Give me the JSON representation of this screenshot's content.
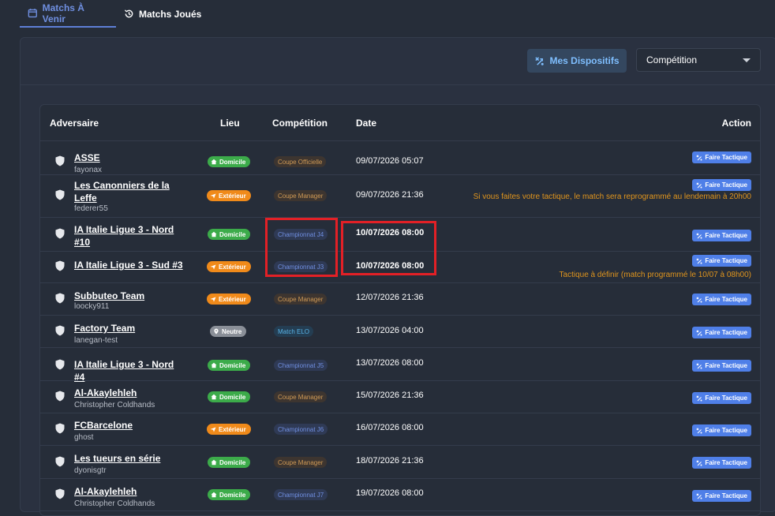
{
  "tabs": [
    {
      "label": "Matchs À Venir",
      "icon": "calendar-icon",
      "active": true
    },
    {
      "label": "Matchs Joués",
      "icon": "history-icon",
      "active": false
    }
  ],
  "toolbar": {
    "dispositifs_label": "Mes Dispositifs",
    "select_value": "Compétition"
  },
  "table": {
    "headers": {
      "adversaire": "Adversaire",
      "lieu": "Lieu",
      "competition": "Compétition",
      "date": "Date",
      "action": "Action"
    },
    "action_label": "Faire Tactique",
    "rows": [
      {
        "name": "ASSE",
        "sub": "fayonax",
        "lieu": "Domicile",
        "competition": "Coupe Officielle",
        "date": "09/07/2026 05:07"
      },
      {
        "name": "Les Canonniers de la Leffe",
        "sub": "federer55",
        "lieu": "Extérieur",
        "competition": "Coupe Manager",
        "date": "09/07/2026 21:36",
        "note": "Si vous faites votre tactique, le match sera reprogrammé au lendemain à 20h00"
      },
      {
        "name": "IA Italie Ligue 3 - Nord #10",
        "sub": "",
        "lieu": "Domicile",
        "competition": "Championnat J4",
        "date": "10/07/2026 08:00"
      },
      {
        "name": "IA Italie Ligue 3 - Sud #3",
        "sub": "",
        "lieu": "Extérieur",
        "competition": "Championnat J3",
        "date": "10/07/2026 08:00",
        "note": "Tactique à définir (match programmé le 10/07 à 08h00)"
      },
      {
        "name": "Subbuteo Team",
        "sub": "loocky911",
        "lieu": "Extérieur",
        "competition": "Coupe Manager",
        "date": "12/07/2026 21:36"
      },
      {
        "name": "Factory Team",
        "sub": "lanegan-test",
        "lieu": "Neutre",
        "competition": "Match ELO",
        "date": "13/07/2026 04:00"
      },
      {
        "name": "IA Italie Ligue 3 - Nord #4",
        "sub": "",
        "lieu": "Domicile",
        "competition": "Championnat J5",
        "date": "13/07/2026 08:00"
      },
      {
        "name": "Al-Akaylehleh",
        "sub": "Christopher Coldhands",
        "lieu": "Domicile",
        "competition": "Coupe Manager",
        "date": "15/07/2026 21:36"
      },
      {
        "name": "FCBarcelone",
        "sub": "ghost",
        "lieu": "Extérieur",
        "competition": "Championnat J6",
        "date": "16/07/2026 08:00"
      },
      {
        "name": "Les tueurs en série",
        "sub": "dyonisgtr",
        "lieu": "Domicile",
        "competition": "Coupe Manager",
        "date": "18/07/2026 21:36"
      },
      {
        "name": "Al-Akaylehleh",
        "sub": "Christopher Coldhands",
        "lieu": "Domicile",
        "competition": "Championnat J7",
        "date": "19/07/2026 08:00"
      }
    ]
  }
}
